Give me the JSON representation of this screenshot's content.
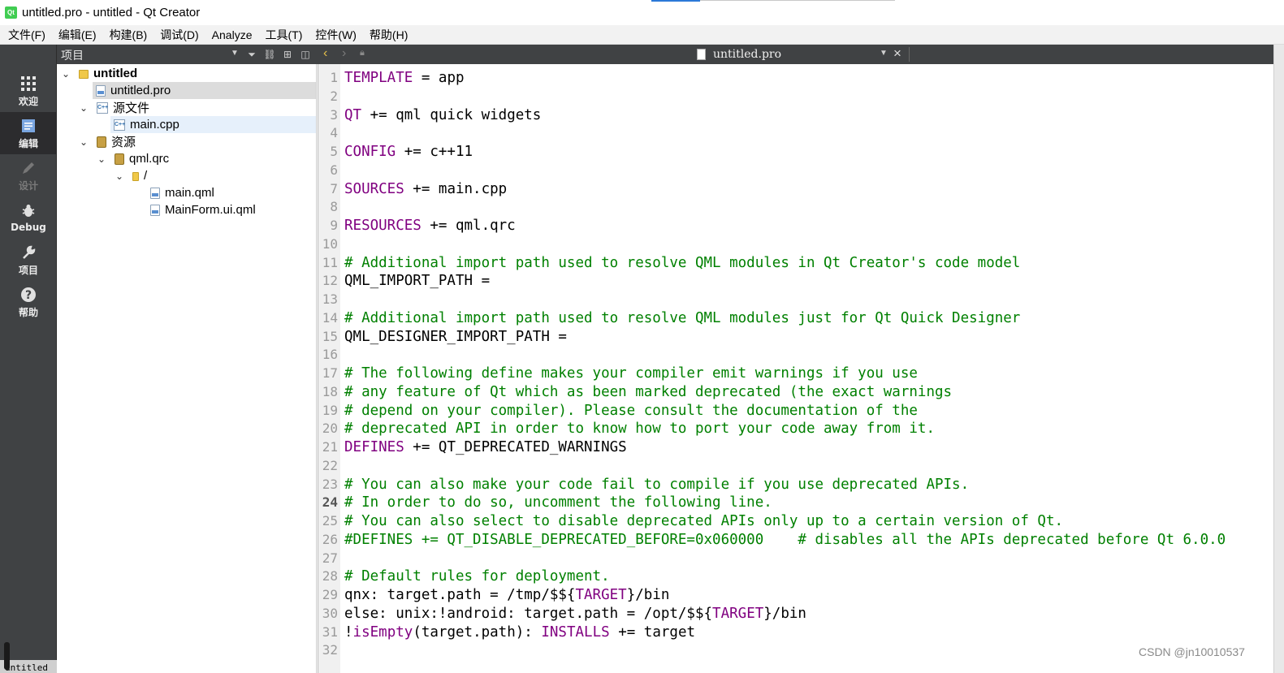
{
  "window": {
    "title": "untitled.pro - untitled - Qt Creator",
    "app_icon_text": "Qt"
  },
  "menu": [
    "文件(F)",
    "编辑(E)",
    "构建(B)",
    "调试(D)",
    "Analyze",
    "工具(T)",
    "控件(W)",
    "帮助(H)"
  ],
  "modes": [
    {
      "label": "欢迎",
      "icon": "grid-icon"
    },
    {
      "label": "编辑",
      "icon": "edit-document-icon",
      "active": true
    },
    {
      "label": "设计",
      "icon": "pencil-icon",
      "disabled": true
    },
    {
      "label": "Debug",
      "icon": "bug-icon"
    },
    {
      "label": "项目",
      "icon": "wrench-icon"
    },
    {
      "label": "帮助",
      "icon": "help-icon"
    }
  ],
  "mode_bottom_tab": "untitled",
  "project_panel": {
    "title": "项目",
    "tree": {
      "root": "untitled",
      "pro_file": "untitled.pro",
      "sources_folder": "源文件",
      "main_cpp": "main.cpp",
      "resources_folder": "资源",
      "qrc": "qml.qrc",
      "slash": "/",
      "main_qml": "main.qml",
      "mainform": "MainForm.ui.qml"
    }
  },
  "editor": {
    "filename": "untitled.pro",
    "current_line": 24,
    "line_numbers": [
      "1",
      "2",
      "3",
      "4",
      "5",
      "6",
      "7",
      "8",
      "9",
      "10",
      "11",
      "12",
      "13",
      "14",
      "15",
      "16",
      "17",
      "18",
      "19",
      "20",
      "21",
      "22",
      "23",
      "24",
      "25",
      "26",
      "27",
      "28",
      "29",
      "30",
      "31",
      "32"
    ],
    "lines": [
      [
        {
          "t": "TEMPLATE",
          "s": "k"
        },
        {
          "t": " = app",
          "s": ""
        }
      ],
      [],
      [
        {
          "t": "QT",
          "s": "k"
        },
        {
          "t": " += qml quick widgets",
          "s": ""
        }
      ],
      [],
      [
        {
          "t": "CONFIG",
          "s": "k"
        },
        {
          "t": " += c++11",
          "s": ""
        }
      ],
      [],
      [
        {
          "t": "SOURCES",
          "s": "k"
        },
        {
          "t": " += main.cpp",
          "s": ""
        }
      ],
      [],
      [
        {
          "t": "RESOURCES",
          "s": "k"
        },
        {
          "t": " += qml.qrc",
          "s": ""
        }
      ],
      [],
      [
        {
          "t": "# Additional import path used to resolve QML modules in Qt Creator's code model",
          "s": "c"
        }
      ],
      [
        {
          "t": "QML_IMPORT_PATH =",
          "s": ""
        }
      ],
      [],
      [
        {
          "t": "# Additional import path used to resolve QML modules just for Qt Quick Designer",
          "s": "c"
        }
      ],
      [
        {
          "t": "QML_DESIGNER_IMPORT_PATH =",
          "s": ""
        }
      ],
      [],
      [
        {
          "t": "# The following define makes your compiler emit warnings if you use",
          "s": "c"
        }
      ],
      [
        {
          "t": "# any feature of Qt which as been marked deprecated (the exact warnings",
          "s": "c"
        }
      ],
      [
        {
          "t": "# depend on your compiler). Please consult the documentation of the",
          "s": "c"
        }
      ],
      [
        {
          "t": "# deprecated API in order to know how to port your code away from it.",
          "s": "c"
        }
      ],
      [
        {
          "t": "DEFINES",
          "s": "k"
        },
        {
          "t": " += QT_DEPRECATED_WARNINGS",
          "s": ""
        }
      ],
      [],
      [
        {
          "t": "# You can also make your code fail to compile if you use deprecated APIs.",
          "s": "c"
        }
      ],
      [
        {
          "t": "# In order to do so, uncomment the following line.",
          "s": "c"
        }
      ],
      [
        {
          "t": "# You can also select to disable deprecated APIs only up to a certain version of Qt.",
          "s": "c"
        }
      ],
      [
        {
          "t": "#DEFINES += QT_DISABLE_DEPRECATED_BEFORE=0x060000    # disables all the APIs deprecated before Qt 6.0.0",
          "s": "c"
        }
      ],
      [],
      [
        {
          "t": "# Default rules for deployment.",
          "s": "c"
        }
      ],
      [
        {
          "t": "qnx: target.path = /tmp/$${",
          "s": ""
        },
        {
          "t": "TARGET",
          "s": "k"
        },
        {
          "t": "}/bin",
          "s": ""
        }
      ],
      [
        {
          "t": "else: unix:!android: target.path = /opt/$${",
          "s": ""
        },
        {
          "t": "TARGET",
          "s": "k"
        },
        {
          "t": "}/bin",
          "s": ""
        }
      ],
      [
        {
          "t": "!",
          "s": ""
        },
        {
          "t": "isEmpty",
          "s": "f"
        },
        {
          "t": "(target.path): ",
          "s": ""
        },
        {
          "t": "INSTALLS",
          "s": "k"
        },
        {
          "t": " += target",
          "s": ""
        }
      ],
      []
    ]
  },
  "watermark": "CSDN @jn10010537"
}
